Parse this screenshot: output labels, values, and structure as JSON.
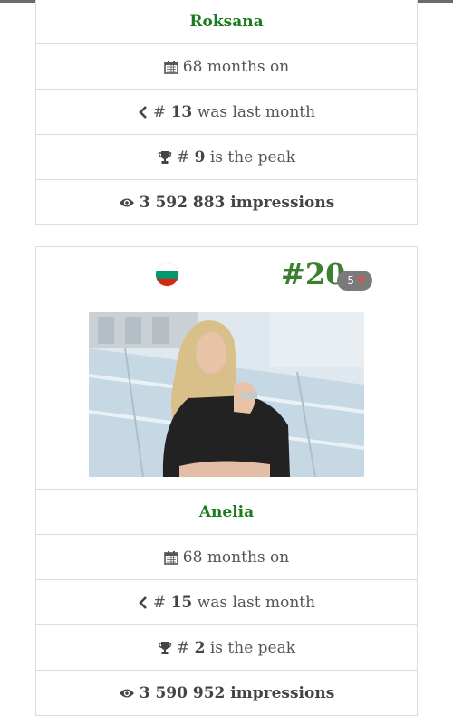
{
  "cards": [
    {
      "name": "Roksana",
      "months_on": "68 months on",
      "last_month_prefix": "# ",
      "last_month_rank": "13",
      "last_month_suffix": " was last month",
      "peak_prefix": "# ",
      "peak_rank": "9",
      "peak_suffix": " is the peak",
      "impressions": "3 592 883 impressions"
    },
    {
      "rank": "#20",
      "change": "-5",
      "flag": "bulgaria",
      "name": "Anelia",
      "months_on": "68 months on",
      "last_month_prefix": "# ",
      "last_month_rank": "15",
      "last_month_suffix": " was last month",
      "peak_prefix": "# ",
      "peak_rank": "2",
      "peak_suffix": " is the peak",
      "impressions": "3 590 952 impressions"
    }
  ],
  "icons": {
    "calendar": "calendar-icon",
    "chevron": "chevron-left-icon",
    "trophy": "trophy-icon",
    "eye": "eye-icon",
    "change_arrow": "arrow-down-icon"
  },
  "colors": {
    "name": "#1b7a1b",
    "rank": "#3d7f2e",
    "badge_bg": "#7a7a7a",
    "badge_arrow": "#d9534f",
    "border": "#dcdcdc"
  }
}
